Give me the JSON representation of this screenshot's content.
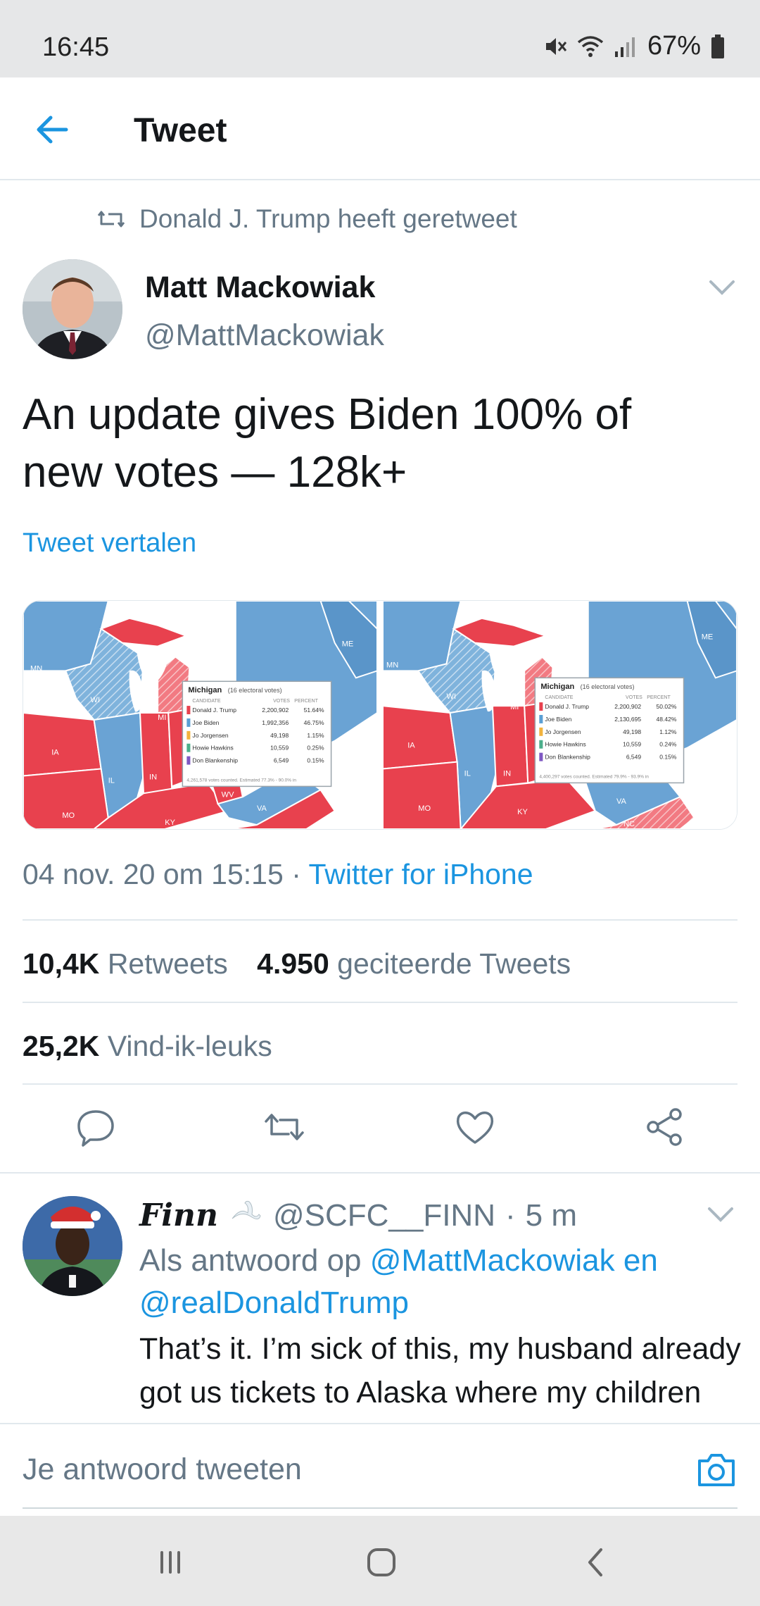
{
  "status_bar": {
    "time": "16:45",
    "battery": "67%"
  },
  "app_bar": {
    "title": "Tweet"
  },
  "tweet": {
    "retweeted_by": "Donald J. Trump heeft geretweet",
    "author_name": "Matt Mackowiak",
    "author_handle": "@MattMackowiak",
    "text_line1": "An update gives Biden 100% of",
    "text_line2": "new votes — 128k+",
    "translate_label": "Tweet vertalen",
    "timestamp": "04 nov. 20 om 15:15",
    "separator": " · ",
    "client": "Twitter for iPhone",
    "retweets_count": "10,4K",
    "retweets_label": "Retweets",
    "quotes_count": "4.950",
    "quotes_label": "geciteerde Tweets",
    "likes_count": "25,2K",
    "likes_label": "Vind-ik-leuks"
  },
  "media": {
    "left": {
      "popup_title": "Michigan",
      "popup_subtitle": "(16 electoral votes)",
      "col_candidate": "CANDIDATE",
      "col_votes": "VOTES",
      "col_percent": "PERCENT",
      "rows": [
        {
          "name": "Donald J. Trump",
          "votes": "2,200,902",
          "pct": "51.64%",
          "color": "#e8414e"
        },
        {
          "name": "Joe Biden",
          "votes": "1,992,356",
          "pct": "46.75%",
          "color": "#5a9fd4"
        },
        {
          "name": "Jo Jorgensen",
          "votes": "49,198",
          "pct": "1.15%",
          "color": "#f2b33d"
        },
        {
          "name": "Howie Hawkins",
          "votes": "10,559",
          "pct": "0.25%",
          "color": "#4caf8b"
        },
        {
          "name": "Don Blankenship",
          "votes": "6,549",
          "pct": "0.15%",
          "color": "#7e57c2"
        }
      ],
      "footer": "4,261,578 votes counted. Estimated 77.3% - 90.0% in",
      "states": [
        "MN",
        "WI",
        "MI",
        "IA",
        "IL",
        "IN",
        "MO",
        "KY",
        "WV",
        "VA",
        "ME"
      ]
    },
    "right": {
      "popup_title": "Michigan",
      "popup_subtitle": "(16 electoral votes)",
      "col_candidate": "CANDIDATE",
      "col_votes": "VOTES",
      "col_percent": "PERCENT",
      "rows": [
        {
          "name": "Donald J. Trump",
          "votes": "2,200,902",
          "pct": "50.02%",
          "color": "#e8414e"
        },
        {
          "name": "Joe Biden",
          "votes": "2,130,695",
          "pct": "48.42%",
          "color": "#5a9fd4"
        },
        {
          "name": "Jo Jorgensen",
          "votes": "49,198",
          "pct": "1.12%",
          "color": "#f2b33d"
        },
        {
          "name": "Howie Hawkins",
          "votes": "10,559",
          "pct": "0.24%",
          "color": "#4caf8b"
        },
        {
          "name": "Don Blankenship",
          "votes": "6,549",
          "pct": "0.15%",
          "color": "#7e57c2"
        }
      ],
      "footer": "4,400,297 votes counted. Estimated 79.9% - 93.9% in",
      "states": [
        "MN",
        "WI",
        "MI",
        "IA",
        "IL",
        "IN",
        "MO",
        "KY",
        "VA",
        "ME",
        "NC"
      ]
    }
  },
  "reply": {
    "display_name": "Finn",
    "handle": "@SCFC__FINN",
    "separator": "·",
    "age": "5 m",
    "replying_prefix": "Als antwoord op",
    "mention1": "@MattMackowiak",
    "conj": "en",
    "mention2": "@realDonaldTrump",
    "text": "That’s it. I’m sick of this, my husband already got us tickets to Alaska where my children and I will reside until the nation..."
  },
  "compose": {
    "placeholder": "Je antwoord tweeten"
  },
  "colors": {
    "accent": "#1b95e0",
    "muted": "#657786",
    "republican": "#e8414e",
    "democrat": "#5a9fd4"
  },
  "icons": {
    "back": "arrow-left-icon",
    "retweet": "retweet-icon",
    "caret": "chevron-down-icon",
    "reply": "reply-icon",
    "like": "heart-icon",
    "share": "share-icon",
    "camera": "camera-icon"
  }
}
